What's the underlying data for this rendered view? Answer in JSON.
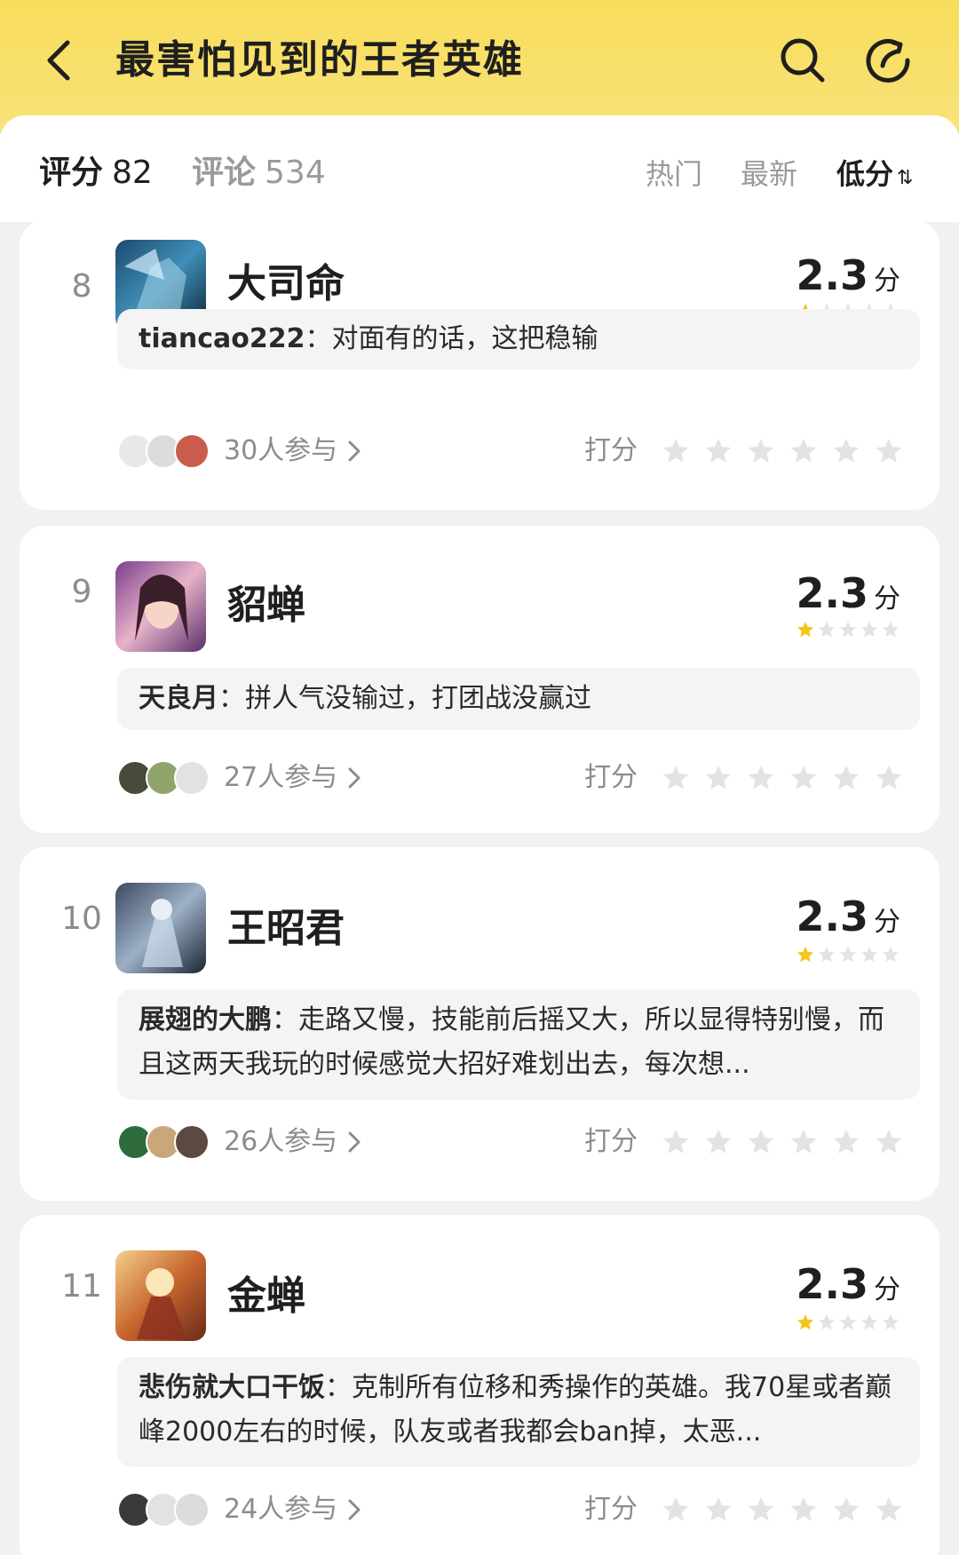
{
  "header": {
    "title": "最害怕见到的王者英雄"
  },
  "stats": {
    "score_label": "评分",
    "score_value": "82",
    "comments_label": "评论",
    "comments_value": "534"
  },
  "sort_tabs": [
    {
      "label": "热门",
      "active": false
    },
    {
      "label": "最新",
      "active": false
    },
    {
      "label": "低分",
      "active": true,
      "icon": "sort-arrows-icon"
    }
  ],
  "items": [
    {
      "rank": "8",
      "name": "大司命",
      "score": "2.3",
      "score_unit": "分",
      "star_rating": 1,
      "comment_user": "tiancao222",
      "comment_text": "对面有的话，这把稳输",
      "participants": "30人参与",
      "rate_label": "打分"
    },
    {
      "rank": "9",
      "name": "貂蝉",
      "score": "2.3",
      "score_unit": "分",
      "star_rating": 1,
      "comment_user": "天良月",
      "comment_text": "拼人气没输过，打团战没赢过",
      "participants": "27人参与",
      "rate_label": "打分"
    },
    {
      "rank": "10",
      "name": "王昭君",
      "score": "2.3",
      "score_unit": "分",
      "star_rating": 1,
      "comment_user": "展翅的大鹏",
      "comment_text": "走路又慢，技能前后摇又大，所以显得特别慢，而且这两天我玩的时候感觉大招好难划出去，每次想...",
      "participants": "26人参与",
      "rate_label": "打分"
    },
    {
      "rank": "11",
      "name": "金蝉",
      "score": "2.3",
      "score_unit": "分",
      "star_rating": 1,
      "comment_user": "悲伤就大口干饭",
      "comment_text": "克制所有位移和秀操作的英雄。我70星或者巅峰2000左右的时候，队友或者我都会ban掉，太恶...",
      "participants": "24人参与",
      "rate_label": "打分"
    }
  ],
  "colors": {
    "header": "#f7dd5a",
    "star_filled": "#f5c518",
    "star_empty": "#e3e3e3"
  }
}
